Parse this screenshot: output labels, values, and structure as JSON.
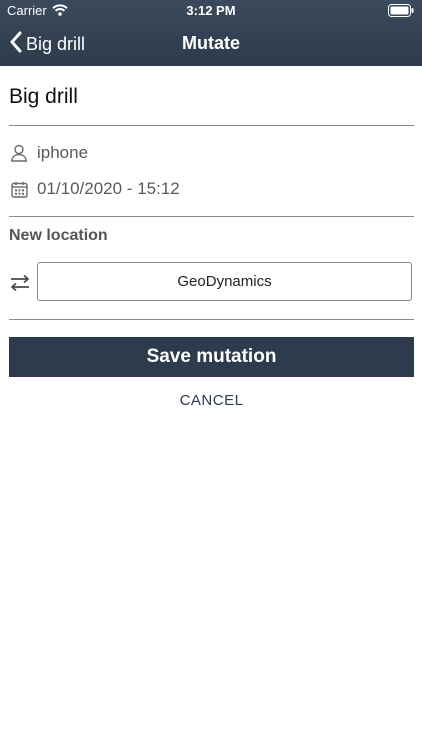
{
  "status_bar": {
    "carrier": "Carrier",
    "time": "3:12 PM",
    "wifi_icon": "wifi-icon",
    "battery_icon": "battery-icon"
  },
  "nav": {
    "back_label": "Big drill",
    "title": "Mutate",
    "back_icon": "chevron-left-icon"
  },
  "item": {
    "name": "Big drill",
    "user": "iphone",
    "datetime": "01/10/2020 - 15:12",
    "user_icon": "person-icon",
    "date_icon": "calendar-icon"
  },
  "form": {
    "section_label": "New location",
    "location_value": "GeoDynamics",
    "swap_icon": "swap-arrows-icon",
    "save_label": "Save mutation",
    "cancel_label": "CANCEL"
  },
  "colors": {
    "header": "#2d3b4c",
    "accent": "#2d3b4c",
    "background": "#ffffff"
  }
}
